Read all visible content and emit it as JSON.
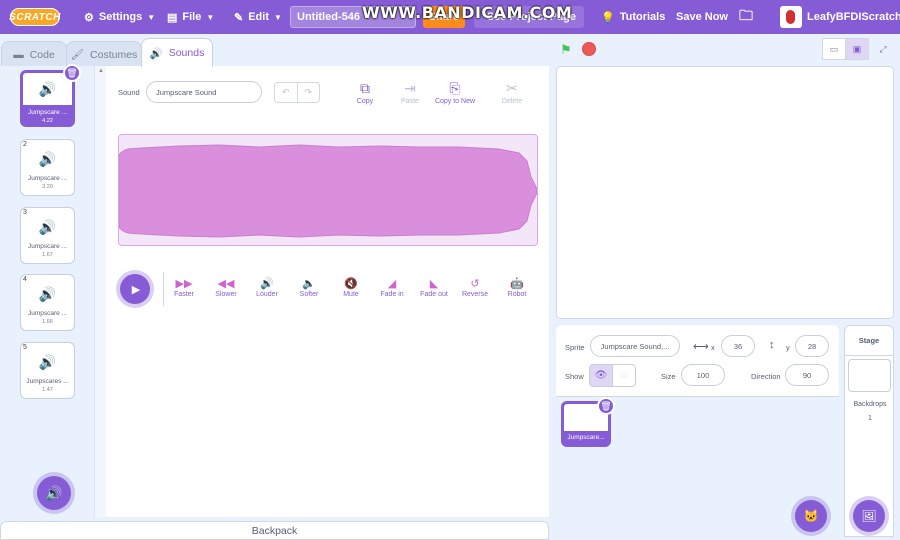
{
  "menubar": {
    "logo": "SCRATCH",
    "settings": "Settings",
    "file": "File",
    "edit": "Edit",
    "project_title": "Untitled-546",
    "share": "Share",
    "see_project": "See Project Page",
    "tutorials": "Tutorials",
    "save_now": "Save Now",
    "username": "LeafyBFDIScratch",
    "watermark": "WWW.BANDICAM.COM"
  },
  "tabs": [
    {
      "label": "Code"
    },
    {
      "label": "Costumes"
    },
    {
      "label": "Sounds"
    }
  ],
  "sounds": [
    {
      "num": "1",
      "name": "Jumpscare ...",
      "duration": "4.22"
    },
    {
      "num": "2",
      "name": "Jumpscare ...",
      "duration": "3.20"
    },
    {
      "num": "3",
      "name": "Jumpscare ...",
      "duration": "1.67"
    },
    {
      "num": "4",
      "name": "Jumpscare ...",
      "duration": "1.66"
    },
    {
      "num": "5",
      "name": "Jumpscares ...",
      "duration": "1.47"
    }
  ],
  "editor": {
    "sound_label": "Sound",
    "sound_name": "Jumpscare Sound",
    "tools": [
      "Copy",
      "Paste",
      "Copy to New",
      "Delete"
    ],
    "effects": [
      "Faster",
      "Slower",
      "Louder",
      "Softer",
      "Mute",
      "Fade in",
      "Fade out",
      "Reverse",
      "Robot"
    ]
  },
  "backpack": "Backpack",
  "sprite_info": {
    "sprite_label": "Sprite",
    "sprite_name": "Jumpscare Sound,...",
    "x_label": "x",
    "x": "36",
    "y_label": "y",
    "y": "28",
    "show_label": "Show",
    "size_label": "Size",
    "size": "100",
    "direction_label": "Direction",
    "direction": "90"
  },
  "sprite_tile_name": "Jumpscare...",
  "stage_pane": {
    "title": "Stage",
    "backdrops_label": "Backdrops",
    "backdrops_count": "1"
  },
  "colors": {
    "accent": "#855cd6",
    "wave_fill": "#d98fdb",
    "share": "#ff8c1a"
  }
}
